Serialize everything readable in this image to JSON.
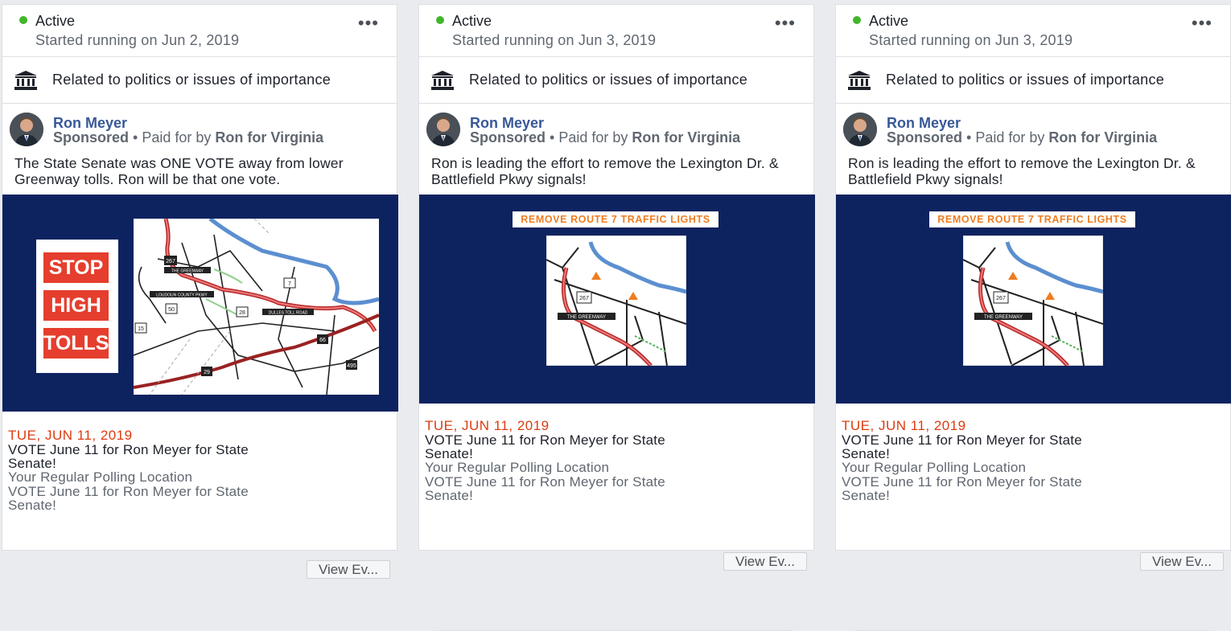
{
  "cards": [
    {
      "status": "Active",
      "started": "Started running on Jun 2, 2019",
      "category": "Related to politics or issues of importance",
      "page_name": "Ron Meyer",
      "sponsored": "Sponsored",
      "paid_for_prefix": "• Paid for by",
      "payer": "Ron for Virginia",
      "ad_text": "The State Senate was ONE VOTE away from lower Greenway tolls. Ron will be that one vote.",
      "creative": {
        "stop_words": [
          "STOP",
          "HIGH",
          "TOLLS"
        ],
        "map_labels": [
          "267",
          "THE GREENWAY",
          "LOUDOUN COUNTY PKWY",
          "50",
          "7",
          "28",
          "DULLES TOLL ROAD",
          "15",
          "66",
          "29",
          "495"
        ]
      },
      "event": {
        "date": "TUE, JUN 11, 2019",
        "title": "VOTE June 11 for Ron Meyer for State Senate!",
        "location": "Your Regular Polling Location",
        "description": "VOTE June 11 for Ron Meyer for State Senate!",
        "button": "View Ev..."
      }
    },
    {
      "status": "Active",
      "started": "Started running on Jun 3, 2019",
      "category": "Related to politics or issues of importance",
      "page_name": "Ron Meyer",
      "sponsored": "Sponsored",
      "paid_for_prefix": "• Paid for by",
      "payer": "Ron for Virginia",
      "ad_text": "Ron is leading the effort to remove the Lexington Dr. & Battlefield Pkwy signals!",
      "creative": {
        "banner": "REMOVE ROUTE 7 TRAFFIC LIGHTS",
        "map_labels": [
          "267",
          "THE GREENWAY"
        ]
      },
      "event": {
        "date": "TUE, JUN 11, 2019",
        "title": "VOTE June 11 for Ron Meyer for State Senate!",
        "location": "Your Regular Polling Location",
        "description": "VOTE June 11 for Ron Meyer for State Senate!",
        "button": "View Ev..."
      }
    },
    {
      "status": "Active",
      "started": "Started running on Jun 3, 2019",
      "category": "Related to politics or issues of importance",
      "page_name": "Ron Meyer",
      "sponsored": "Sponsored",
      "paid_for_prefix": "• Paid for by",
      "payer": "Ron for Virginia",
      "ad_text": "Ron is leading the effort to remove the Lexington Dr. & Battlefield Pkwy signals!",
      "creative": {
        "banner": "REMOVE ROUTE 7 TRAFFIC LIGHTS",
        "map_labels": [
          "267",
          "THE GREENWAY"
        ]
      },
      "event": {
        "date": "TUE, JUN 11, 2019",
        "title": "VOTE June 11 for Ron Meyer for State Senate!",
        "location": "Your Regular Polling Location",
        "description": "VOTE June 11 for Ron Meyer for State Senate!",
        "button": "View Ev..."
      }
    }
  ],
  "colors": {
    "active_dot": "#42b72a",
    "page_name": "#385898",
    "event_date": "#dd3c10",
    "creative_bg": "#0d2360",
    "stop_red": "#e53e2e",
    "banner_orange": "#f07c1f"
  },
  "icons": [
    "status-dot-icon",
    "more-options-icon",
    "government-building-icon"
  ]
}
